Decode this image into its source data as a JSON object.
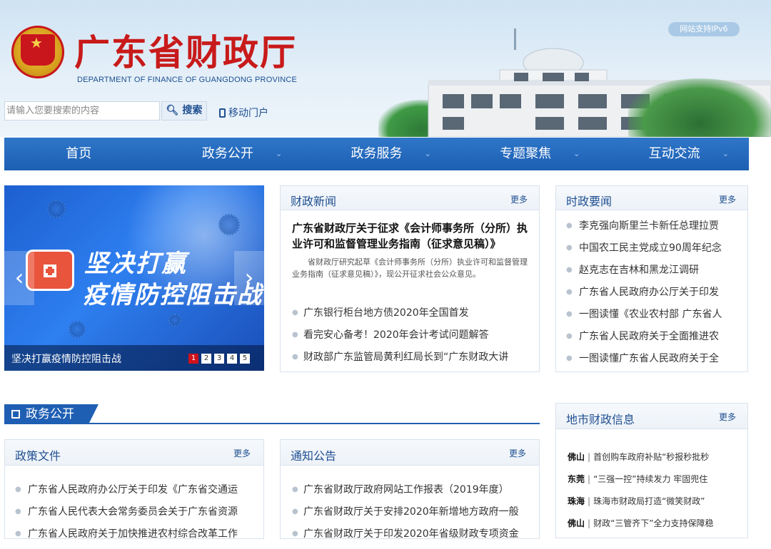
{
  "header": {
    "title": "广东省财政厅",
    "subtitle": "DEPARTMENT OF FINANCE OF GUANGDONG PROVINCE",
    "ipv6_badge": "网站支持IPv6",
    "search_placeholder": "请输入您要搜索的内容",
    "search_button": "搜索",
    "mobile_link": "移动门户"
  },
  "nav": {
    "items": [
      {
        "label": "首页",
        "has_dropdown": false
      },
      {
        "label": "政务公开",
        "has_dropdown": true
      },
      {
        "label": "政务服务",
        "has_dropdown": true
      },
      {
        "label": "专题聚焦",
        "has_dropdown": true
      },
      {
        "label": "互动交流",
        "has_dropdown": true
      }
    ],
    "chevron": "⌄"
  },
  "slider": {
    "headline_1": "坚决打赢",
    "headline_2": "疫情防控阻击战",
    "caption": "坚决打赢疫情防控阻击战",
    "prev": "‹",
    "next": "›",
    "pages": [
      "1",
      "2",
      "3",
      "4",
      "5"
    ],
    "active_page": 1
  },
  "finance_news": {
    "title": "财政新闻",
    "more": "更多",
    "headline": "广东省财政厅关于征求《会计师事务所（分所）执业许可和监督管理业务指南（征求意见稿）》",
    "summary": "省财政厅研究起草《会计师事务所（分所）执业许可和监督管理业务指南（征求意见稿）》，现公开征求社会公众意见。",
    "items": [
      "广东银行柜台地方债2020年全国首发",
      "看完安心备考！2020年会计考试问题解答",
      "财政部广东监管局黄利红局长到“广东财政大讲"
    ]
  },
  "policy_news": {
    "title": "时政要闻",
    "more": "更多",
    "items": [
      "李克强向斯里兰卡新任总理拉贾",
      "中国农工民主党成立90周年纪念",
      "赵克志在吉林和黑龙江调研",
      "广东省人民政府办公厅关于印发",
      "一图读懂《农业农村部 广东省人",
      "广东省人民政府关于全面推进农",
      "一图读懂广东省人民政府关于全"
    ]
  },
  "section": {
    "title": "政务公开"
  },
  "policy_docs": {
    "title": "政策文件",
    "more": "更多",
    "items": [
      "广东省人民政府办公厅关于印发《广东省交通运",
      "广东省人民代表大会常务委员会关于广东省资源",
      "广东省人民政府关于加快推进农村综合改革工作"
    ]
  },
  "notices": {
    "title": "通知公告",
    "more": "更多",
    "items": [
      "广东省财政厅政府网站工作报表（2019年度）",
      "广东省财政厅关于安排2020年新增地方政府一般",
      "广东省财政厅关于印发2020年省级财政专项资金"
    ]
  },
  "city_finance": {
    "title": "地市财政信息",
    "more": "更多",
    "items": [
      {
        "city": "佛山",
        "text": "首创购车政府补贴“秒报秒批秒"
      },
      {
        "city": "东莞",
        "text": "“三强一控”持续发力 牢固兜住"
      },
      {
        "city": "珠海",
        "text": "珠海市财政局打造“微笑财政”"
      },
      {
        "city": "佛山",
        "text": "财政“三管齐下”全力支持保障稳"
      }
    ]
  }
}
